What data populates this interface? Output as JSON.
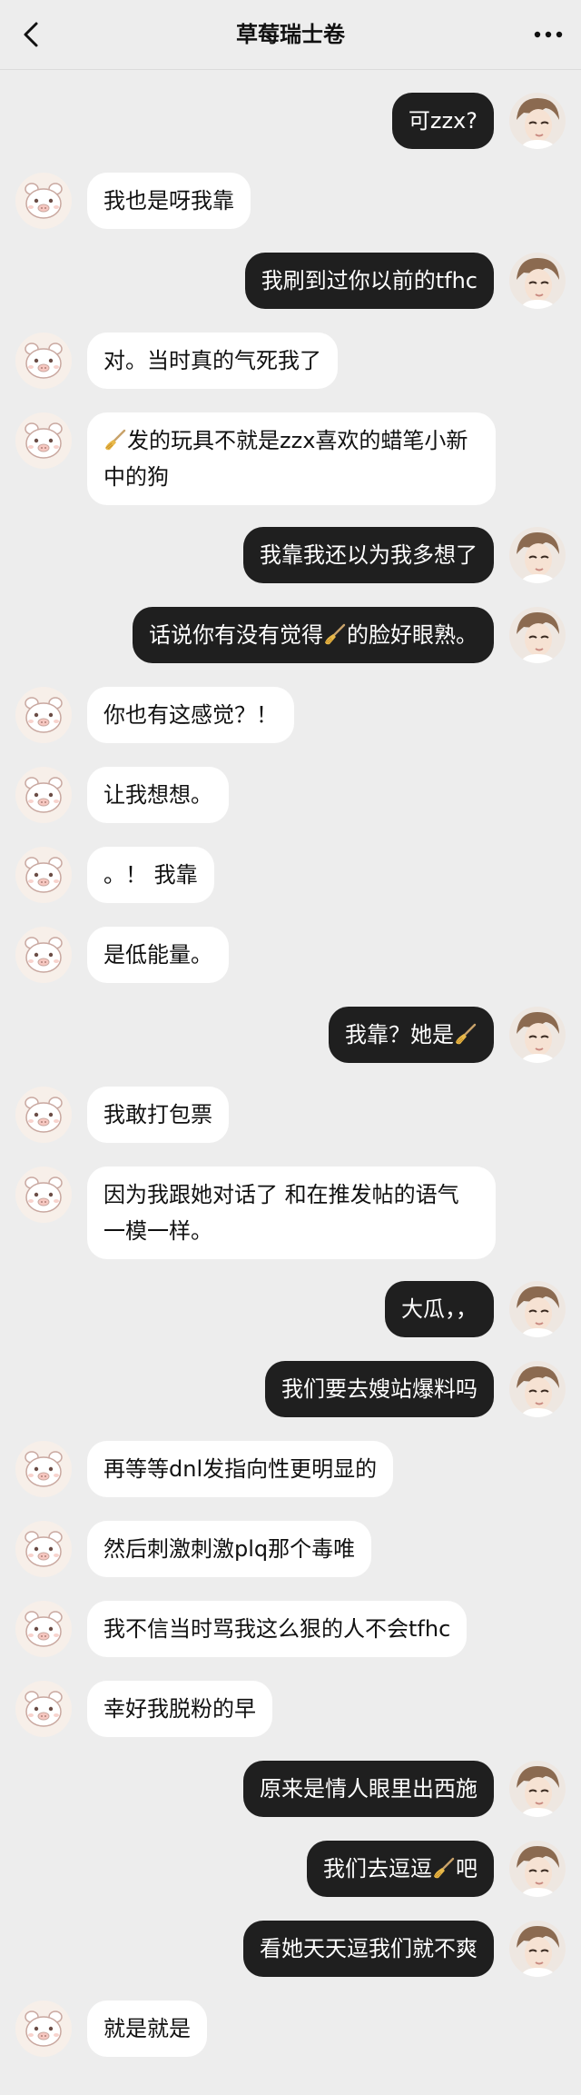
{
  "header": {
    "title": "草莓瑞士卷",
    "back_icon": "chevron-left-icon",
    "more_icon": "more-dots-icon"
  },
  "colors": {
    "background": "#ededed",
    "incoming_bubble": "#ffffff",
    "outgoing_bubble": "#1f1f1f"
  },
  "messages": [
    {
      "side": "out",
      "text": "可zzx?"
    },
    {
      "side": "in",
      "text": "我也是呀我靠"
    },
    {
      "side": "out",
      "text": "我刷到过你以前的tfhc"
    },
    {
      "side": "in",
      "text": "对。当时真的气死我了"
    },
    {
      "side": "in",
      "pre_icon": "broom-emoji",
      "text": "发的玩具不就是zzx喜欢的蜡笔小新中的狗"
    },
    {
      "side": "out",
      "text": "我靠我还以为我多想了"
    },
    {
      "side": "out",
      "text": "话说你有没有觉得",
      "mid_icon": "broom-emoji",
      "text_after": "的脸好眼熟。"
    },
    {
      "side": "in",
      "text": "你也有这感觉？！"
    },
    {
      "side": "in",
      "text": "让我想想。"
    },
    {
      "side": "in",
      "text": "。！ 我靠"
    },
    {
      "side": "in",
      "text": "是低能量。"
    },
    {
      "side": "out",
      "text": "我靠？她是",
      "end_icon": "broom-emoji"
    },
    {
      "side": "in",
      "text": "我敢打包票"
    },
    {
      "side": "in",
      "text": "因为我跟她对话了 和在推发帖的语气一模一样。"
    },
    {
      "side": "out",
      "text": "大瓜，，"
    },
    {
      "side": "out",
      "text": "我们要去嫂站爆料吗"
    },
    {
      "side": "in",
      "text": "再等等dnl发指向性更明显的"
    },
    {
      "side": "in",
      "text": "然后刺激刺激plq那个毒唯"
    },
    {
      "side": "in",
      "text": "我不信当时骂我这么狠的人不会tfhc"
    },
    {
      "side": "in",
      "text": "幸好我脱粉的早"
    },
    {
      "side": "out",
      "text": "原来是情人眼里出西施"
    },
    {
      "side": "out",
      "text": "我们去逗逗",
      "mid_icon": "broom-emoji",
      "text_after": "吧"
    },
    {
      "side": "out",
      "text": "看她天天逗我们就不爽"
    },
    {
      "side": "in",
      "text": "就是就是"
    }
  ]
}
